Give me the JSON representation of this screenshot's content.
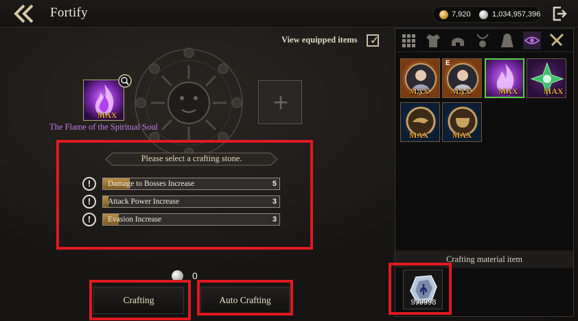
{
  "header": {
    "title": "Fortify",
    "gold": "7,920",
    "silver": "1,034,957,396"
  },
  "view_equipped": {
    "label": "View equipped items",
    "checked": true
  },
  "selected_item": {
    "name": "The Flame of the Spiritual Soul",
    "level": "MAX"
  },
  "options": {
    "prompt": "Please select a crafting stone.",
    "rows": [
      {
        "label": "Damage to Bosses Increase",
        "value": "5",
        "fill": 0.15
      },
      {
        "label": "Attack Power Increase",
        "value": "3",
        "fill": 0.03
      },
      {
        "label": "Evasion Increase",
        "value": "3",
        "fill": 0.09
      }
    ]
  },
  "cost": {
    "icon": "silver-coin-icon",
    "value": "0"
  },
  "buttons": {
    "crafting": "Crafting",
    "auto_crafting": "Auto Crafting"
  },
  "inventory": {
    "tabs": [
      "grid-icon",
      "armor-icon",
      "helmet-icon",
      "amulet-icon",
      "cloak-icon",
      "eye-icon",
      "crossed-swords-icon"
    ],
    "items": [
      {
        "name": "portrait-item-1",
        "level": "MAX",
        "equipped": ""
      },
      {
        "name": "portrait-item-2",
        "level": "MAX",
        "equipped": "E"
      },
      {
        "name": "flame-soul-item",
        "level": "MAX",
        "equipped": ""
      },
      {
        "name": "green-star-item",
        "level": "MAX",
        "equipped": ""
      },
      {
        "name": "dragon-emblem-item",
        "level": "MAX",
        "equipped": ""
      },
      {
        "name": "cauldron-emblem-item",
        "level": "MAX",
        "equipped": ""
      }
    ]
  },
  "material": {
    "header": "Crafting material item",
    "count": "999998"
  }
}
